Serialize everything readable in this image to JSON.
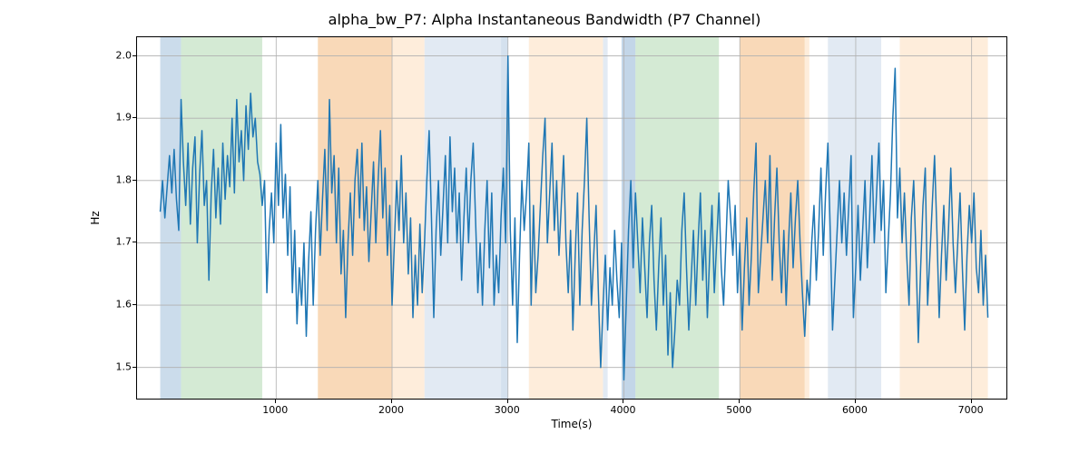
{
  "chart_data": {
    "type": "line",
    "title": "alpha_bw_P7: Alpha Instantaneous Bandwidth (P7 Channel)",
    "xlabel": "Time(s)",
    "ylabel": "Hz",
    "xlim": [
      -200,
      7300
    ],
    "ylim": [
      1.45,
      2.03
    ],
    "xticks": [
      1000,
      2000,
      3000,
      4000,
      5000,
      6000,
      7000
    ],
    "yticks": [
      1.5,
      1.6,
      1.7,
      1.8,
      1.9,
      2.0
    ],
    "background_bands": [
      {
        "x0": 0,
        "x1": 180,
        "color": "#a9c4de",
        "alpha": 0.6
      },
      {
        "x0": 180,
        "x1": 880,
        "color": "#b7dcb7",
        "alpha": 0.6
      },
      {
        "x0": 1360,
        "x1": 2000,
        "color": "#f6c99a",
        "alpha": 0.7
      },
      {
        "x0": 2000,
        "x1": 2280,
        "color": "#fde5cc",
        "alpha": 0.7
      },
      {
        "x0": 2280,
        "x1": 2940,
        "color": "#d6e1ee",
        "alpha": 0.7
      },
      {
        "x0": 2940,
        "x1": 3000,
        "color": "#a9c4de",
        "alpha": 0.5
      },
      {
        "x0": 3180,
        "x1": 3820,
        "color": "#fde5cc",
        "alpha": 0.7
      },
      {
        "x0": 3820,
        "x1": 3860,
        "color": "#d6e1ee",
        "alpha": 0.7
      },
      {
        "x0": 3980,
        "x1": 4100,
        "color": "#a9c4de",
        "alpha": 0.7
      },
      {
        "x0": 4100,
        "x1": 4820,
        "color": "#b7dcb7",
        "alpha": 0.6
      },
      {
        "x0": 5000,
        "x1": 5560,
        "color": "#f6c99a",
        "alpha": 0.7
      },
      {
        "x0": 5560,
        "x1": 5600,
        "color": "#fde5cc",
        "alpha": 0.7
      },
      {
        "x0": 5760,
        "x1": 6220,
        "color": "#d6e1ee",
        "alpha": 0.7
      },
      {
        "x0": 6380,
        "x1": 7140,
        "color": "#fde5cc",
        "alpha": 0.7
      }
    ],
    "series": [
      {
        "name": "alpha_bw_P7",
        "color": "#1f77b4",
        "x_start": 0,
        "x_step": 20,
        "y": [
          1.75,
          1.8,
          1.74,
          1.79,
          1.84,
          1.78,
          1.85,
          1.77,
          1.72,
          1.93,
          1.83,
          1.76,
          1.86,
          1.73,
          1.82,
          1.87,
          1.7,
          1.81,
          1.88,
          1.76,
          1.8,
          1.64,
          1.78,
          1.85,
          1.74,
          1.82,
          1.73,
          1.86,
          1.77,
          1.84,
          1.79,
          1.9,
          1.78,
          1.93,
          1.83,
          1.88,
          1.8,
          1.92,
          1.85,
          1.94,
          1.87,
          1.9,
          1.83,
          1.81,
          1.76,
          1.8,
          1.62,
          1.72,
          1.78,
          1.7,
          1.86,
          1.76,
          1.89,
          1.74,
          1.81,
          1.68,
          1.79,
          1.62,
          1.72,
          1.57,
          1.66,
          1.6,
          1.7,
          1.55,
          1.67,
          1.75,
          1.6,
          1.72,
          1.8,
          1.68,
          1.77,
          1.85,
          1.72,
          1.93,
          1.78,
          1.84,
          1.7,
          1.82,
          1.65,
          1.72,
          1.58,
          1.7,
          1.78,
          1.68,
          1.8,
          1.85,
          1.74,
          1.86,
          1.72,
          1.79,
          1.67,
          1.75,
          1.83,
          1.7,
          1.8,
          1.88,
          1.74,
          1.82,
          1.68,
          1.76,
          1.6,
          1.7,
          1.8,
          1.72,
          1.84,
          1.7,
          1.78,
          1.65,
          1.74,
          1.58,
          1.68,
          1.6,
          1.73,
          1.62,
          1.7,
          1.8,
          1.88,
          1.74,
          1.58,
          1.72,
          1.8,
          1.68,
          1.76,
          1.84,
          1.7,
          1.87,
          1.75,
          1.82,
          1.7,
          1.78,
          1.64,
          1.74,
          1.82,
          1.7,
          1.8,
          1.86,
          1.74,
          1.62,
          1.7,
          1.6,
          1.72,
          1.8,
          1.66,
          1.78,
          1.6,
          1.68,
          1.62,
          1.74,
          1.82,
          1.7,
          2.0,
          1.72,
          1.6,
          1.74,
          1.54,
          1.68,
          1.8,
          1.72,
          1.78,
          1.86,
          1.6,
          1.76,
          1.62,
          1.68,
          1.76,
          1.84,
          1.9,
          1.7,
          1.78,
          1.86,
          1.72,
          1.8,
          1.68,
          1.76,
          1.84,
          1.7,
          1.62,
          1.72,
          1.56,
          1.68,
          1.78,
          1.6,
          1.72,
          1.8,
          1.9,
          1.74,
          1.6,
          1.68,
          1.76,
          1.62,
          1.5,
          1.6,
          1.68,
          1.56,
          1.66,
          1.6,
          1.72,
          1.64,
          1.58,
          1.7,
          1.48,
          1.6,
          1.72,
          1.8,
          1.66,
          1.78,
          1.7,
          1.62,
          1.74,
          1.66,
          1.58,
          1.7,
          1.76,
          1.64,
          1.56,
          1.66,
          1.74,
          1.6,
          1.68,
          1.52,
          1.62,
          1.5,
          1.56,
          1.64,
          1.6,
          1.72,
          1.78,
          1.66,
          1.56,
          1.64,
          1.72,
          1.6,
          1.7,
          1.78,
          1.64,
          1.72,
          1.58,
          1.68,
          1.76,
          1.62,
          1.7,
          1.78,
          1.66,
          1.6,
          1.7,
          1.8,
          1.74,
          1.68,
          1.76,
          1.62,
          1.7,
          1.56,
          1.66,
          1.74,
          1.6,
          1.68,
          1.78,
          1.86,
          1.62,
          1.68,
          1.74,
          1.8,
          1.7,
          1.84,
          1.64,
          1.74,
          1.82,
          1.7,
          1.62,
          1.72,
          1.6,
          1.7,
          1.78,
          1.66,
          1.74,
          1.8,
          1.7,
          1.62,
          1.55,
          1.64,
          1.6,
          1.7,
          1.76,
          1.64,
          1.72,
          1.82,
          1.68,
          1.78,
          1.86,
          1.72,
          1.56,
          1.64,
          1.72,
          1.8,
          1.7,
          1.78,
          1.68,
          1.76,
          1.84,
          1.58,
          1.66,
          1.76,
          1.64,
          1.72,
          1.8,
          1.66,
          1.74,
          1.84,
          1.7,
          1.78,
          1.86,
          1.72,
          1.8,
          1.62,
          1.7,
          1.78,
          1.9,
          1.98,
          1.74,
          1.82,
          1.7,
          1.78,
          1.68,
          1.6,
          1.74,
          1.8,
          1.68,
          1.54,
          1.66,
          1.76,
          1.82,
          1.6,
          1.68,
          1.76,
          1.84,
          1.72,
          1.58,
          1.68,
          1.76,
          1.64,
          1.72,
          1.82,
          1.7,
          1.62,
          1.7,
          1.78,
          1.66,
          1.56,
          1.68,
          1.76,
          1.7,
          1.78,
          1.66,
          1.62,
          1.72,
          1.6,
          1.68,
          1.58
        ]
      }
    ]
  }
}
